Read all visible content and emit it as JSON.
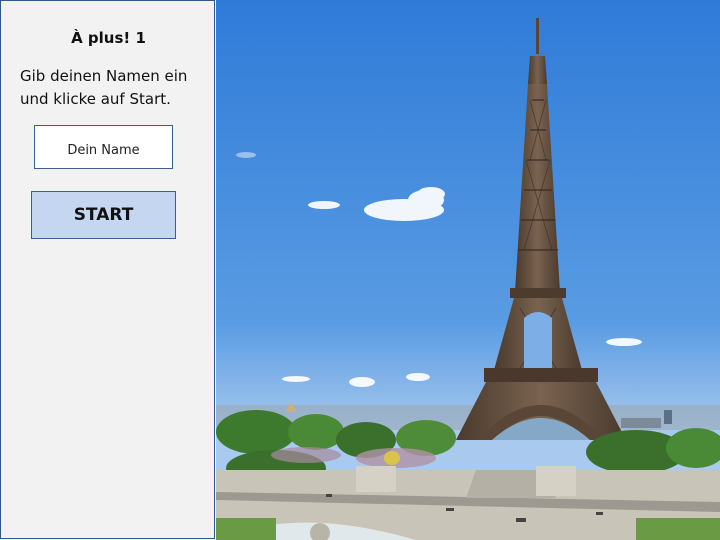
{
  "panel": {
    "title": "À plus! 1",
    "instruction": "Gib deinen Namen ein und klicke auf Start.",
    "name_input": {
      "placeholder": "Dein Name",
      "value": ""
    },
    "start_label": "START"
  },
  "image": {
    "subject": "eiffel-tower-photo",
    "colors": {
      "sky": "#3d86dc",
      "tower": "#5e4a3a",
      "trees": "#3f7a35"
    }
  }
}
